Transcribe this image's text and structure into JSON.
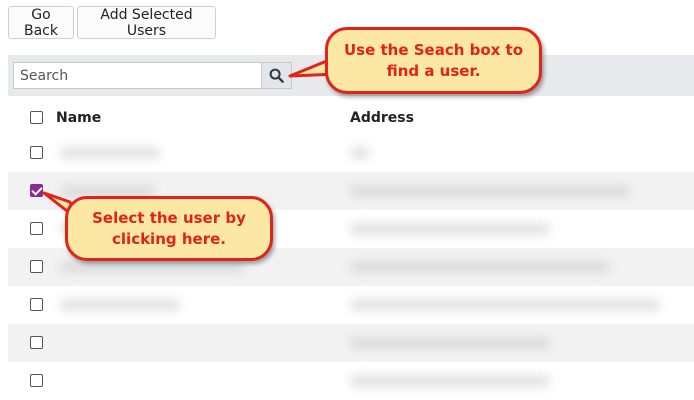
{
  "toolbar": {
    "go_back_label": "Go Back",
    "add_selected_label": "Add Selected Users"
  },
  "search": {
    "placeholder": "Search",
    "button_icon": "search-icon"
  },
  "table": {
    "columns": [
      "Name",
      "Address"
    ],
    "rows": [
      {
        "checked": false,
        "name_hidden": true,
        "address_hidden": true
      },
      {
        "checked": true,
        "name_hidden": true,
        "address_hidden": true
      },
      {
        "checked": false,
        "name_hidden": true,
        "address_hidden": true
      },
      {
        "checked": false,
        "name_hidden": true,
        "address_hidden": true
      },
      {
        "checked": false,
        "name_hidden": true,
        "address_hidden": true
      },
      {
        "checked": false,
        "name_hidden": true,
        "address_hidden": true
      },
      {
        "checked": false,
        "name_hidden": true,
        "address_hidden": true
      }
    ]
  },
  "callouts": {
    "search_tip": "Use the Seach box to find a user.",
    "select_tip": "Select the user by clicking here."
  },
  "colors": {
    "accent": "#8a2a92",
    "callout_fill": "#fde7a4",
    "callout_border": "#e0241b",
    "search_bar_bg": "#e7e9ec"
  }
}
